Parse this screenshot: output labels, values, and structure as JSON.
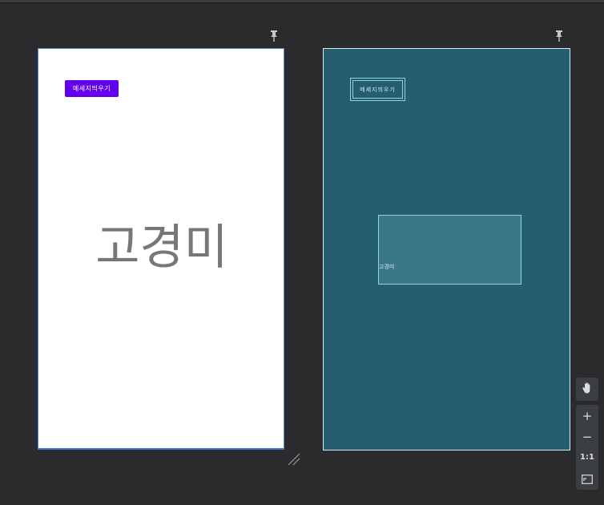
{
  "design_view": {
    "button_label": "메세지띄우기",
    "center_text": "고경미"
  },
  "blueprint_view": {
    "button_label": "메세지띄우기",
    "text_label": "고경미"
  },
  "toolbar": {
    "pan_icon": "hand-icon",
    "zoom_in_label": "+",
    "zoom_out_label": "−",
    "actual_size_label": "1:1",
    "fit_screen_icon": "fit-screen-icon"
  },
  "colors": {
    "canvas": "#2b2b2d",
    "button_accent": "#6200ee",
    "blueprint_bg": "#245e6f",
    "blueprint_line": "#8fd3e3"
  }
}
